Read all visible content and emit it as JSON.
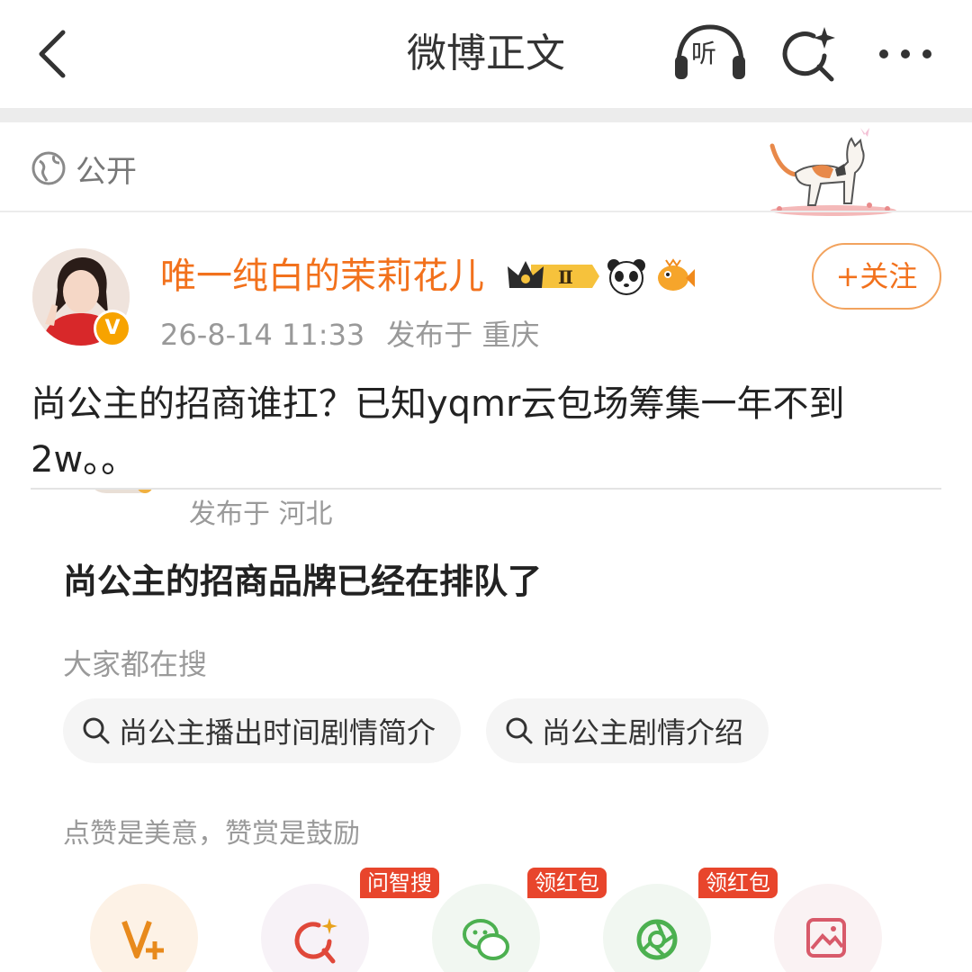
{
  "header": {
    "title": "微博正文",
    "listen_label": "听"
  },
  "post": {
    "visibility": "公开",
    "author": {
      "name": "唯一纯白的茉莉花儿",
      "verified_badge": "V",
      "level_badge": "Ⅱ"
    },
    "time": "26-8-14 11:33",
    "location": "发布于 重庆",
    "follow_label": "+关注",
    "text": "尚公主的招商谁扛？已知yqmr云包场筹集一年不到2w。。"
  },
  "embedded": {
    "location": "发布于 河北",
    "title": "尚公主的招商品牌已经在排队了",
    "search_label": "大家都在搜",
    "search_chips": [
      "尚公主播出时间剧情简介",
      "尚公主剧情介绍"
    ],
    "like_label": "点赞是美意，赞赏是鼓励",
    "action_tags": {
      "ask": "问智搜",
      "redpack1": "领红包",
      "redpack2": "领红包"
    }
  },
  "colors": {
    "accent_orange": "#f2711c",
    "tag_red": "#e8452c",
    "wechat_green": "#4cb050"
  },
  "icons": [
    "back-icon",
    "listen-icon",
    "search-sparkle-icon",
    "more-icon",
    "globe-icon",
    "crown-icon",
    "panda-icon",
    "fish-icon",
    "search-icon",
    "vplus-icon",
    "ai-search-icon",
    "wechat-icon",
    "moments-icon",
    "image-save-icon"
  ]
}
